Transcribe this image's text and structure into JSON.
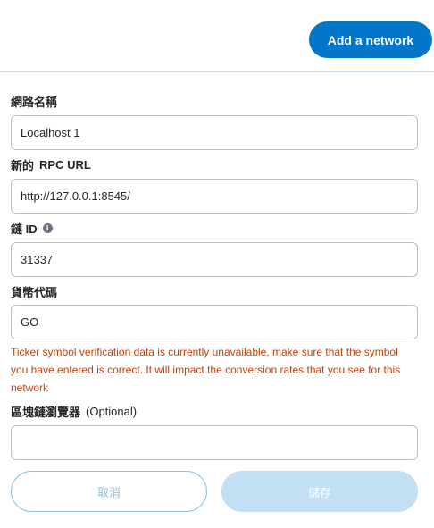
{
  "header": {
    "add_network_label": "Add a network"
  },
  "form": {
    "network_name": {
      "label": "網路名稱",
      "value": "Localhost 1"
    },
    "rpc_url": {
      "label_prefix": "新的",
      "label_suffix": "RPC URL",
      "value": "http://127.0.0.1:8545/"
    },
    "chain_id": {
      "label": "鏈 ID",
      "value": "31337",
      "info_icon": "info-icon"
    },
    "currency_symbol": {
      "label": "貨幣代碼",
      "value": "GO"
    },
    "warning": "Ticker symbol verification data is currently unavailable, make sure that the symbol you have entered is correct. It will impact the conversion rates that you see for this network",
    "explorer": {
      "label_prefix": "區塊鏈瀏覽器",
      "label_suffix": "(Optional)",
      "value": ""
    }
  },
  "actions": {
    "cancel_label": "取消",
    "save_label": "儲存"
  },
  "colors": {
    "primary": "#0376c9",
    "warning": "#c2410c",
    "border": "#bbc0c5"
  }
}
